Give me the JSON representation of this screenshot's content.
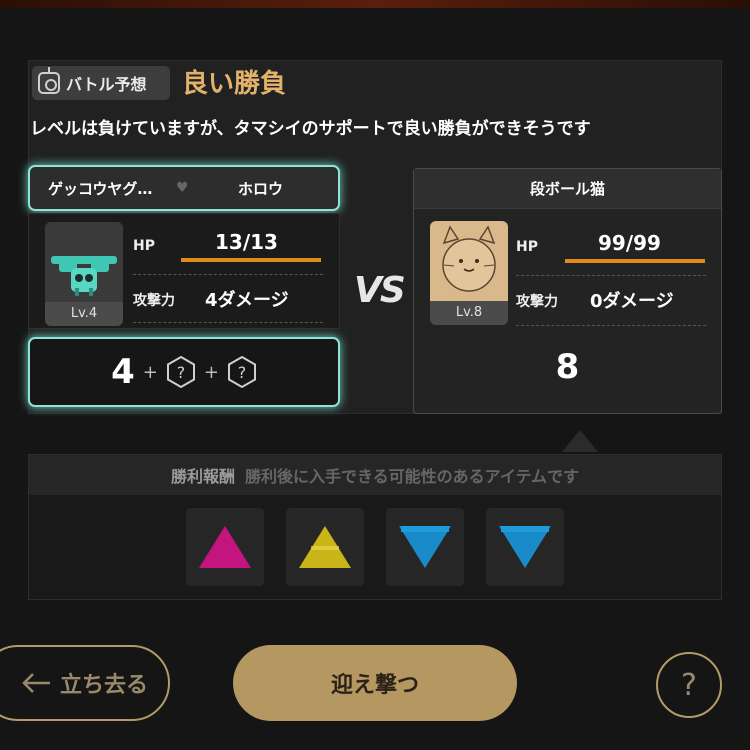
{
  "header": {
    "prediction_chip": "バトル予想",
    "result_title": "良い勝負",
    "description": "レベルは負けていますが、タマシイのサポートで良い勝負ができそうです"
  },
  "player": {
    "name": "ゲッコウヤグ…",
    "partner": "ホロウ",
    "level": "Lv.4",
    "hp_label": "HP",
    "hp_value": "13/13",
    "atk_label": "攻撃力",
    "atk_value": "4ダメージ",
    "power": "4",
    "plus": "+",
    "unknown": "?"
  },
  "vs": "VS",
  "enemy": {
    "name": "段ボール猫",
    "level": "Lv.8",
    "hp_label": "HP",
    "hp_value": "99/99",
    "atk_label": "攻撃力",
    "atk_value": "0ダメージ",
    "power": "8"
  },
  "reward": {
    "title": "勝利報酬",
    "subtitle": "勝利後に入手できる可能性のあるアイテムです",
    "items": [
      {
        "icon": "magenta-up-triangle-icon",
        "color": "#c4157f"
      },
      {
        "icon": "yellow-up-triangle-icon",
        "color": "#c9b517"
      },
      {
        "icon": "blue-down-triangle-icon",
        "color": "#1a8bc9"
      },
      {
        "icon": "blue-down-triangle-icon",
        "color": "#1a8bc9"
      }
    ]
  },
  "buttons": {
    "leave": "立ち去る",
    "fight": "迎え撃つ",
    "help": "?"
  },
  "colors": {
    "accent_gold": "#e2b26b",
    "hp_bar": "#e08b17",
    "glow": "#8fe4d8"
  }
}
